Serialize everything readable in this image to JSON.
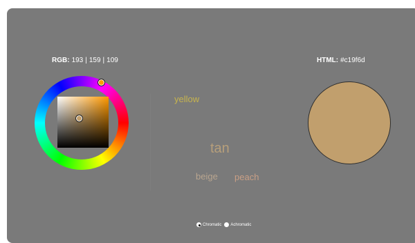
{
  "readouts": {
    "rgb_label": "RGB:",
    "r": "193",
    "g": "159",
    "b": "109",
    "separator": "|",
    "html_label": "HTML:",
    "html_value": "#c19f6d"
  },
  "color_names": {
    "yellow": "yellow",
    "tan": "tan",
    "beige": "beige",
    "peach": "peach"
  },
  "mode": {
    "chromatic_label": "Chromatic",
    "achromatic_label": "Achromatic",
    "selected": "Chromatic"
  },
  "colors": {
    "panel_bg": "#7a7a7a",
    "current": "#c19f6d",
    "hue": "#ff9b00"
  },
  "icons": {
    "hue_handle": "circle-handle",
    "sv_handle": "circle-handle"
  }
}
